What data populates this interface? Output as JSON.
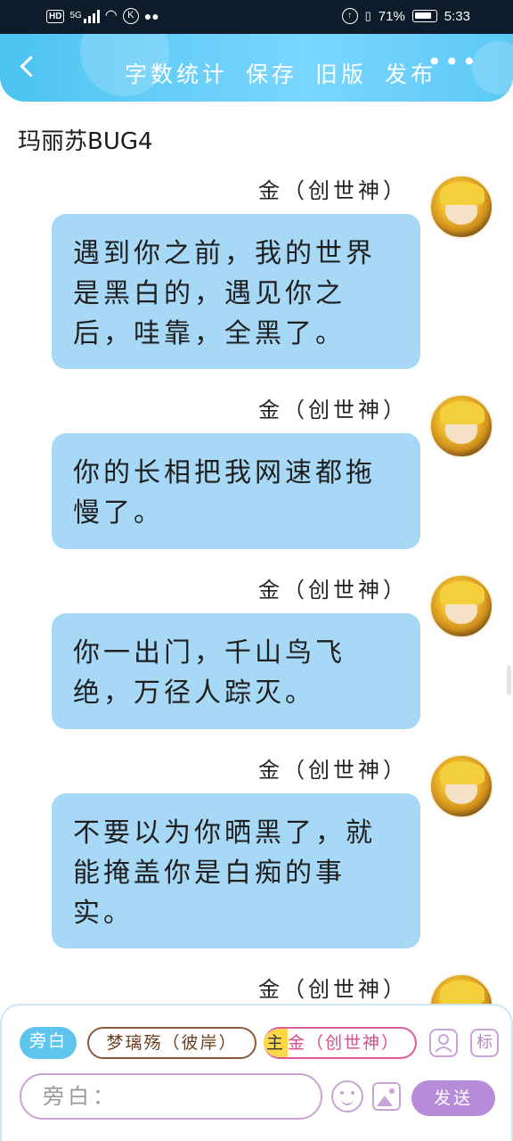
{
  "status_bar": {
    "hd": "HD",
    "network": "5G",
    "nfc": "K",
    "battery_percent": "71%",
    "battery_level": 0.71,
    "time": "5:33"
  },
  "header": {
    "actions": [
      "字数统计",
      "保存",
      "旧版",
      "发布"
    ],
    "more": "•••"
  },
  "doc_title": "玛丽苏BUG4",
  "messages": [
    {
      "sender": "金（创世神）",
      "text": "遇到你之前，我的世界是黑白的，遇见你之后，哇靠，全黑了。"
    },
    {
      "sender": "金（创世神）",
      "text": "你的长相把我网速都拖慢了。"
    },
    {
      "sender": "金（创世神）",
      "text": "你一出门，千山鸟飞绝，万径人踪灭。"
    },
    {
      "sender": "金（创世神）",
      "text": "不要以为你晒黑了，就能掩盖你是白痴的事实。"
    },
    {
      "sender": "金（创世神）",
      "text": ""
    }
  ],
  "input_panel": {
    "narrator_chip": "旁白",
    "role_chip_1": "梦璃殇（彼岸）",
    "role_chip_2_tag": "主",
    "role_chip_2": "金（创世神）",
    "icon_profile": "profile-icon",
    "icon_tag": "标",
    "input_placeholder": "旁白：",
    "send_label": "发送"
  }
}
